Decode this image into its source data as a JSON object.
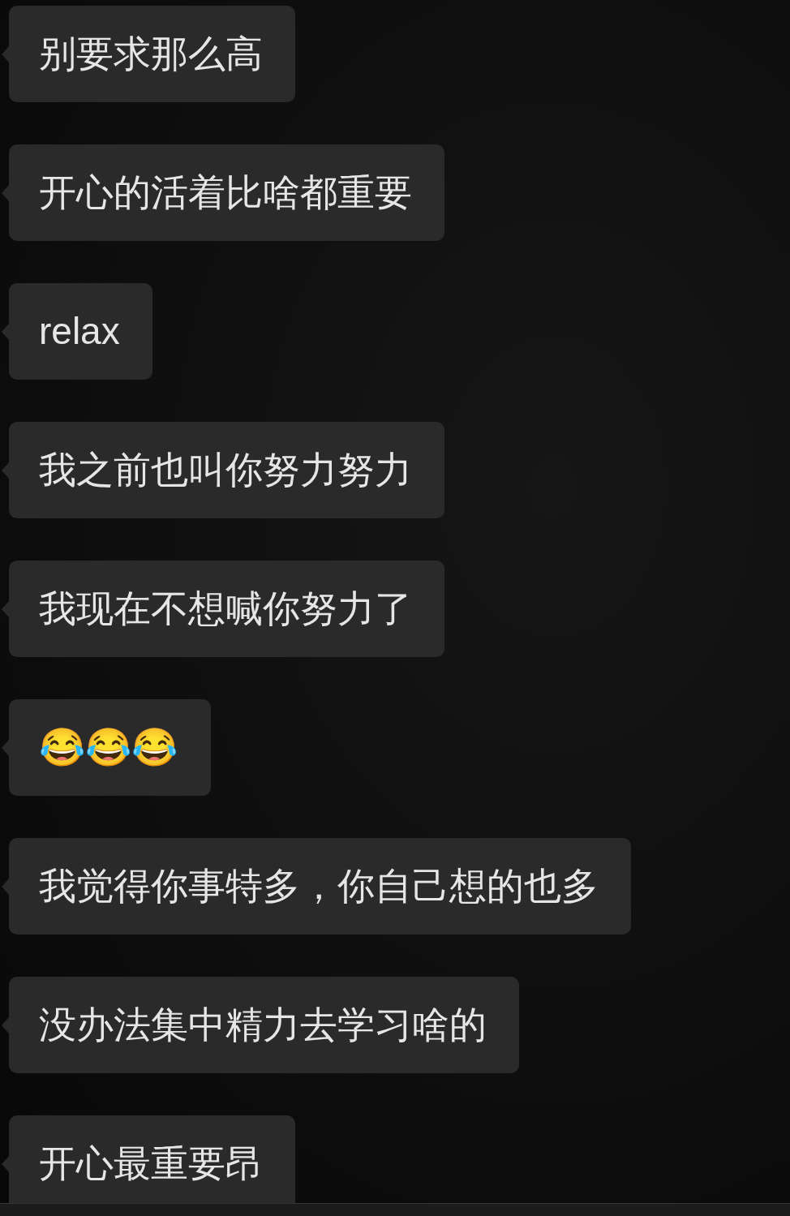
{
  "messages": [
    {
      "text": "别要求那么高"
    },
    {
      "text": "开心的活着比啥都重要"
    },
    {
      "text": "relax"
    },
    {
      "text": "我之前也叫你努力努力"
    },
    {
      "text": "我现在不想喊你努力了"
    },
    {
      "text": "😂😂😂"
    },
    {
      "text": "我觉得你事特多，你自己想的也多"
    },
    {
      "text": "没办法集中精力去学习啥的"
    },
    {
      "text": "开心最重要昂"
    }
  ]
}
